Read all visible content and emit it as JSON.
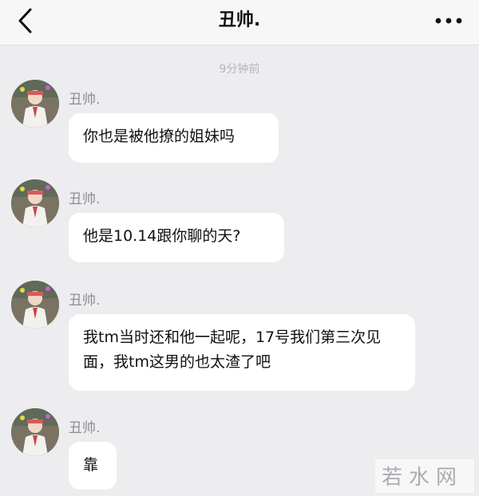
{
  "header": {
    "title": "丑帅.",
    "back_icon": "chevron-left-icon",
    "more_icon": "ellipsis-icon"
  },
  "timestamp": "9分钟前",
  "messages": [
    {
      "sender": "丑帅.",
      "text": "你也是被他撩的姐妹吗"
    },
    {
      "sender": "丑帅.",
      "text": "他是10.14跟你聊的天?"
    },
    {
      "sender": "丑帅.",
      "text": "我tm当时还和他一起呢，17号我们第三次见面，我tm这男的也太渣了吧"
    },
    {
      "sender": "丑帅.",
      "text": "靠"
    }
  ],
  "watermark": "若水网",
  "colors": {
    "background": "#ededf0",
    "bubble": "#ffffff",
    "header": "#f7f7f7"
  }
}
